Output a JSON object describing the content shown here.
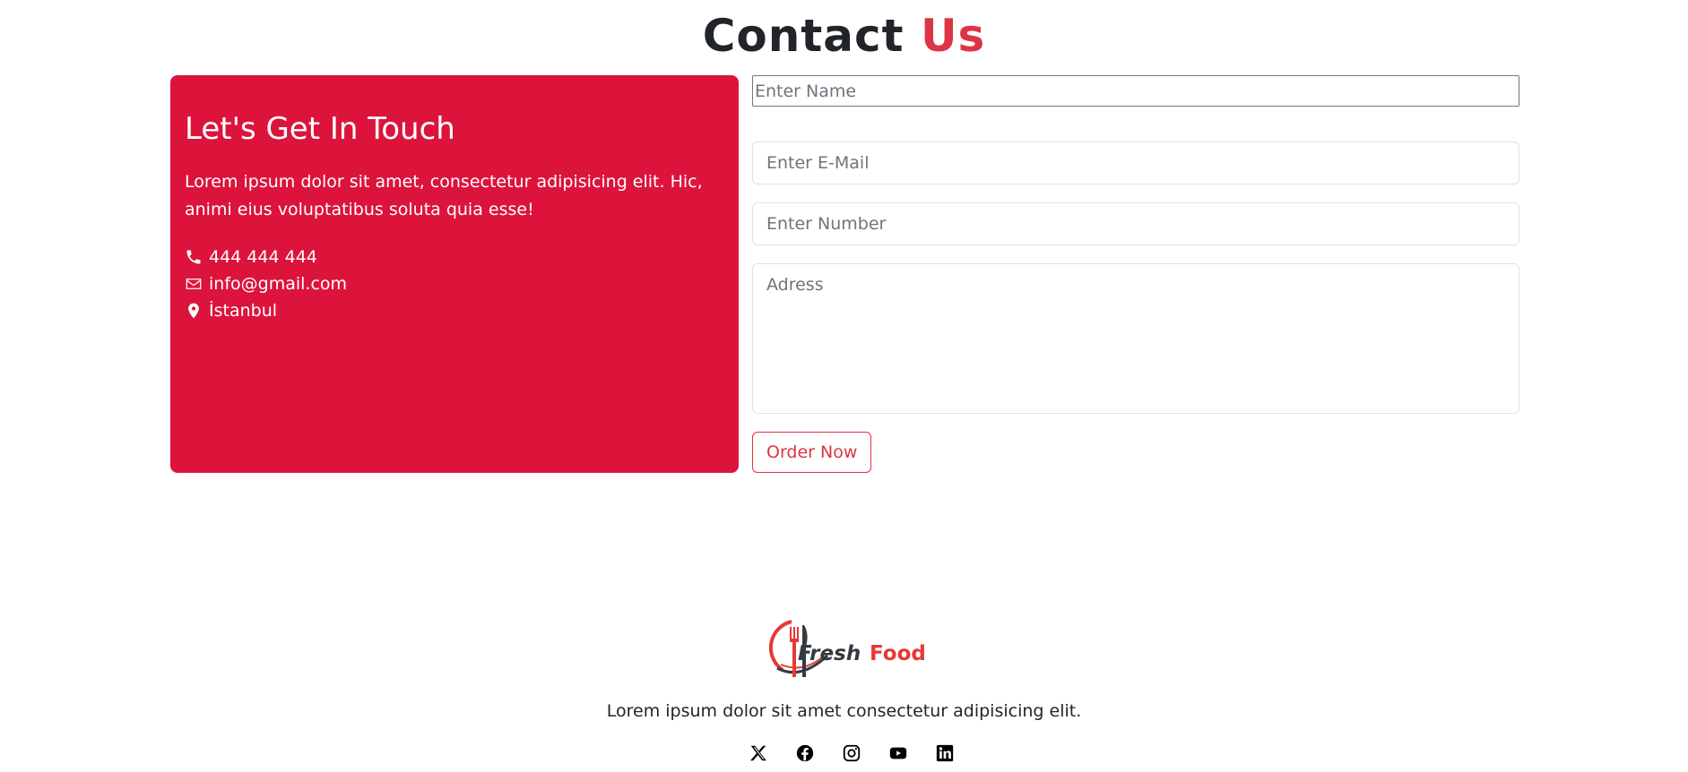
{
  "header": {
    "title_main": "Contact",
    "title_accent": "Us"
  },
  "info": {
    "heading": "Let's Get In Touch",
    "description": "Lorem ipsum dolor sit amet, consectetur adipisicing elit. Hic, animi eius voluptatibus soluta quia esse!",
    "phone": "444 444 444",
    "email": "info@gmail.com",
    "location": "İstanbul"
  },
  "form": {
    "name_placeholder": "Enter Name",
    "email_placeholder": "Enter E-Mail",
    "number_placeholder": "Enter Number",
    "address_placeholder": "Adress",
    "submit_label": "Order Now"
  },
  "footer": {
    "brand_word1": "Fresh",
    "brand_word2": "Food",
    "text": "Lorem ipsum dolor sit amet consectetur adipisicing elit.",
    "socials": [
      "x-icon",
      "facebook-icon",
      "instagram-icon",
      "youtube-icon",
      "linkedin-icon"
    ]
  },
  "colors": {
    "accent": "#dc3545",
    "card_bg": "#dc143c",
    "text_dark": "#212529"
  }
}
